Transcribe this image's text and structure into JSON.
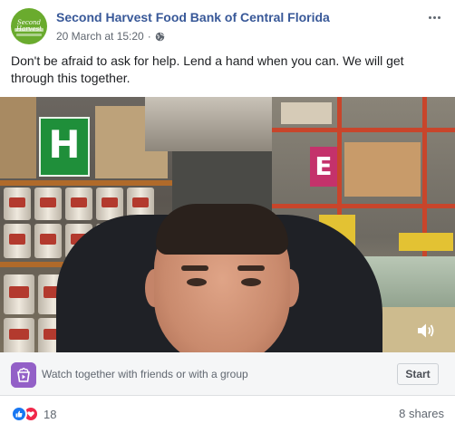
{
  "post": {
    "page_name": "Second Harvest Food Bank of Central Florida",
    "avatar_text": "Second Harvest",
    "timestamp": "20 March at 15:20",
    "separator": "·",
    "audience_icon": "globe-icon",
    "more_icon": "more-options-icon",
    "text": "Don't be afraid to ask for help. Lend a hand when you can. We will get through this together."
  },
  "video": {
    "sign_h": "H",
    "sign_e": "E",
    "volume_icon": "volume-icon"
  },
  "watch_together": {
    "icon": "watch-party-icon",
    "label": "Watch together with friends or with a group",
    "button_label": "Start"
  },
  "footer": {
    "reaction_icons": [
      "like-icon",
      "love-icon"
    ],
    "reaction_count": "18",
    "shares": "8 shares"
  },
  "colors": {
    "page_name": "#385898",
    "meta_text": "#606770",
    "like": "#1877f2",
    "love": "#f0284a",
    "watch_icon": "#9360c7",
    "avatar": "#6aab2e"
  }
}
